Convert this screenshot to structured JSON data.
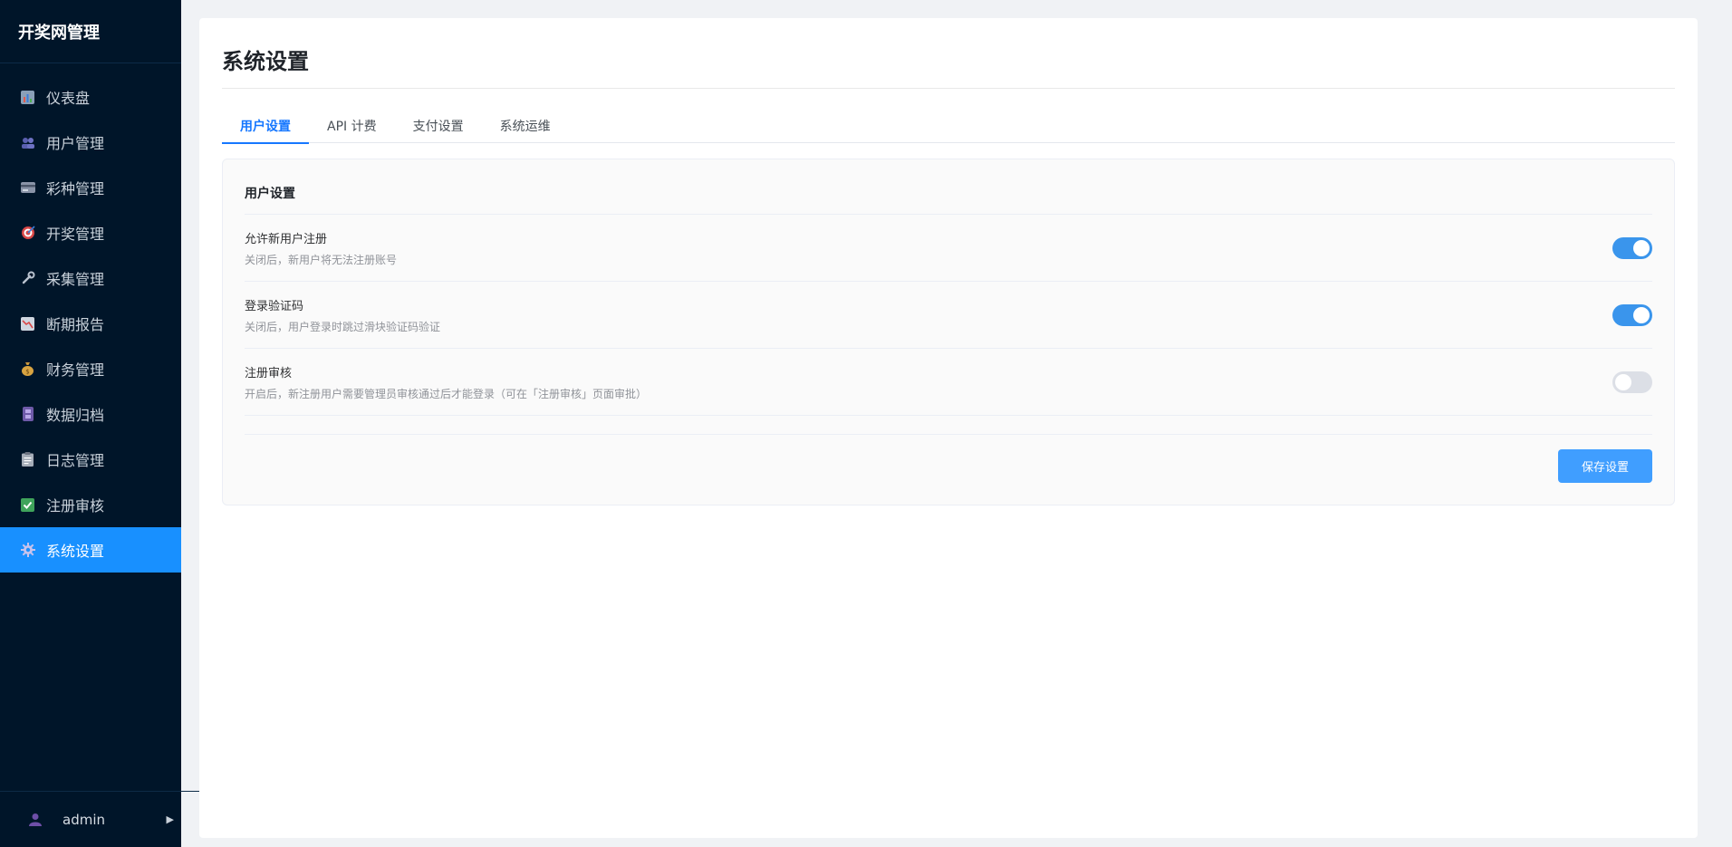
{
  "sidebar": {
    "brand": "开奖网管理",
    "items": [
      {
        "label": "仪表盘",
        "icon": "bar-chart-icon"
      },
      {
        "label": "用户管理",
        "icon": "users-icon"
      },
      {
        "label": "彩种管理",
        "icon": "card-icon"
      },
      {
        "label": "开奖管理",
        "icon": "target-icon"
      },
      {
        "label": "采集管理",
        "icon": "wrench-icon"
      },
      {
        "label": "断期报告",
        "icon": "chart-down-icon"
      },
      {
        "label": "财务管理",
        "icon": "money-bag-icon"
      },
      {
        "label": "数据归档",
        "icon": "archive-icon"
      },
      {
        "label": "日志管理",
        "icon": "clipboard-icon"
      },
      {
        "label": "注册审核",
        "icon": "check-icon"
      },
      {
        "label": "系统设置",
        "icon": "gear-icon"
      }
    ],
    "footer": {
      "user": "admin",
      "caret": "▶"
    }
  },
  "page": {
    "title": "系统设置",
    "tabs": [
      {
        "label": "用户设置"
      },
      {
        "label": "API 计费"
      },
      {
        "label": "支付设置"
      },
      {
        "label": "系统运维"
      }
    ]
  },
  "card": {
    "title": "用户设置",
    "settings": [
      {
        "label": "允许新用户注册",
        "desc": "关闭后，新用户将无法注册账号",
        "enabled": true
      },
      {
        "label": "登录验证码",
        "desc": "关闭后，用户登录时跳过滑块验证码验证",
        "enabled": true
      },
      {
        "label": "注册审核",
        "desc": "开启后，新注册用户需要管理员审核通过后才能登录（可在「注册审核」页面审批）",
        "enabled": false
      }
    ],
    "save_label": "保存设置"
  },
  "colors": {
    "sidebar_bg": "#001529",
    "active_menu": "#1890ff",
    "accent": "#1677ff",
    "switch_on": "#3a95ec",
    "button": "#409eff"
  }
}
